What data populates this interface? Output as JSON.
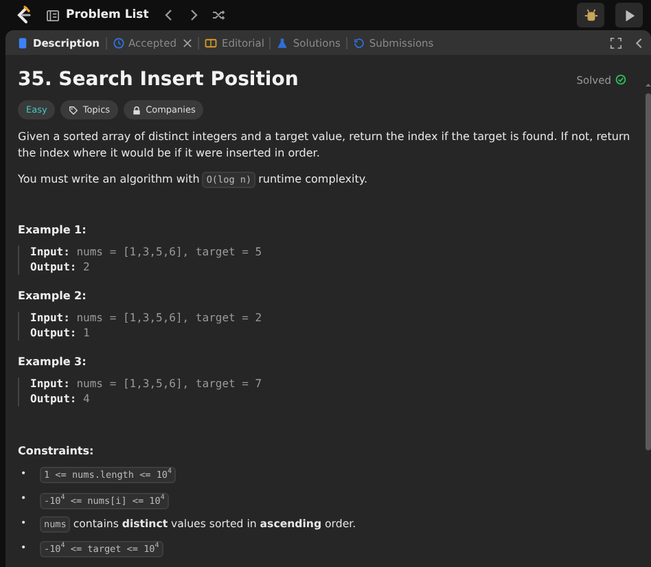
{
  "top_bar": {
    "problem_list": "Problem List"
  },
  "tabs": [
    {
      "label": "Description",
      "selected": true,
      "closable": false
    },
    {
      "label": "Accepted",
      "selected": false,
      "closable": true
    },
    {
      "label": "Editorial",
      "selected": false,
      "closable": false
    },
    {
      "label": "Solutions",
      "selected": false,
      "closable": false
    },
    {
      "label": "Submissions",
      "selected": false,
      "closable": false
    }
  ],
  "problem": {
    "title": "35. Search Insert Position",
    "status": "Solved",
    "tags": [
      {
        "label": "Easy",
        "kind": "difficulty"
      },
      {
        "label": "Topics",
        "kind": "topics"
      },
      {
        "label": "Companies",
        "kind": "companies"
      }
    ],
    "paragraphs": [
      [
        {
          "kind": "text",
          "text": "Given a sorted array of distinct integers and a target value, return the index if the target is found. If not, return the index where it would be if it were inserted in order."
        }
      ],
      [
        {
          "kind": "text",
          "text": "You must write an algorithm with"
        },
        {
          "kind": "code",
          "text": "O(log n)"
        },
        {
          "kind": "text",
          "text": "runtime complexity."
        }
      ]
    ],
    "examples": [
      {
        "heading": "Example 1:",
        "input_label": "Input:",
        "input": "nums = [1,3,5,6], target = 5",
        "output_label": "Output:",
        "output": "2"
      },
      {
        "heading": "Example 2:",
        "input_label": "Input:",
        "input": "nums = [1,3,5,6], target = 2",
        "output_label": "Output:",
        "output": "1"
      },
      {
        "heading": "Example 3:",
        "input_label": "Input:",
        "input": "nums = [1,3,5,6], target = 7",
        "output_label": "Output:",
        "output": "4"
      }
    ],
    "constraints_heading": "Constraints:",
    "constraints": [
      {
        "bullet": "•",
        "parts": [
          {
            "kind": "code",
            "text": "1 <= nums.length <= 10$^{4}$"
          }
        ]
      },
      {
        "bullet": "•",
        "parts": [
          {
            "kind": "code",
            "text": "-10$^{4}$ <= nums[i] <= 10$^{4}$"
          }
        ]
      },
      {
        "bullet": "•",
        "parts": [
          {
            "kind": "code",
            "text": "nums"
          },
          {
            "kind": "text",
            "text": "contains **distinct** values sorted in **ascending** order."
          }
        ]
      },
      {
        "bullet": "•",
        "parts": [
          {
            "kind": "code",
            "text": "-10$^{4}$ <= target <= 10$^{4}$"
          }
        ]
      }
    ]
  }
}
